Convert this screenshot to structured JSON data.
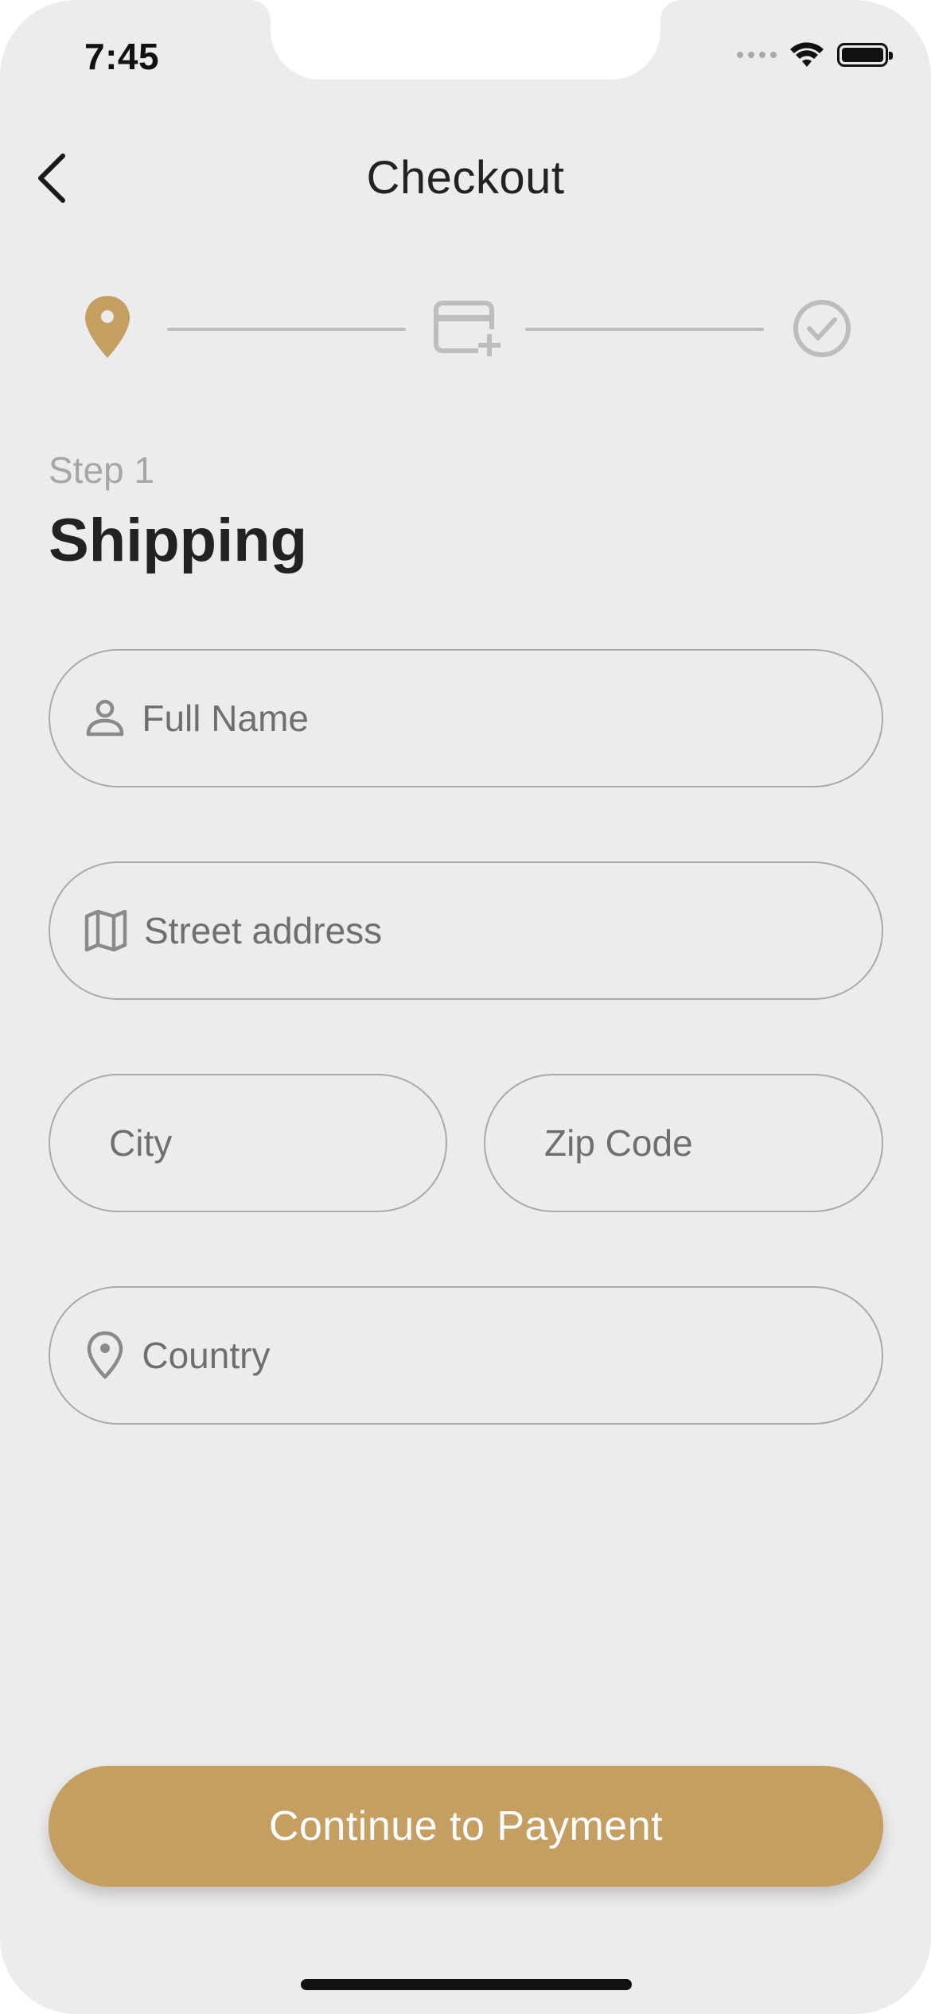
{
  "status_bar": {
    "time": "7:45"
  },
  "header": {
    "title": "Checkout",
    "back_icon": "chevron-left-icon"
  },
  "stepper": {
    "active_color": "#C59F62",
    "inactive_color": "#BDBDBD",
    "steps": [
      {
        "icon": "location-pin-icon",
        "state": "active"
      },
      {
        "icon": "add-card-icon",
        "state": "inactive"
      },
      {
        "icon": "check-circle-icon",
        "state": "inactive"
      }
    ]
  },
  "section": {
    "step_label": "Step 1",
    "title": "Shipping"
  },
  "form": {
    "full_name": {
      "placeholder": "Full Name",
      "value": "",
      "icon": "person-icon"
    },
    "street": {
      "placeholder": "Street address",
      "value": "",
      "icon": "map-icon"
    },
    "city": {
      "placeholder": "City",
      "value": ""
    },
    "zip": {
      "placeholder": "Zip Code",
      "value": ""
    },
    "country": {
      "placeholder": "Country",
      "value": "",
      "icon": "location-pin-icon"
    }
  },
  "cta": {
    "label": "Continue to Payment",
    "color": "#C59F62"
  }
}
